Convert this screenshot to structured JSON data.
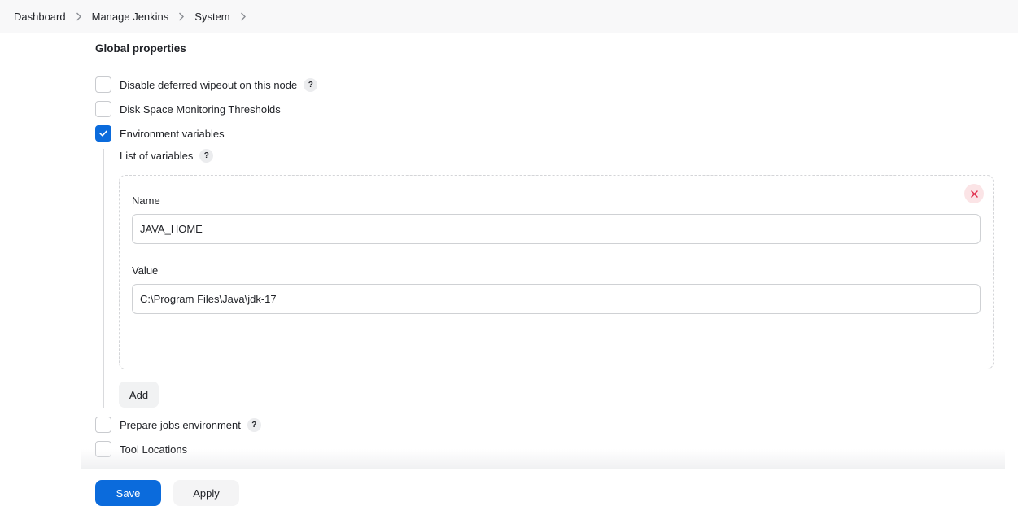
{
  "breadcrumb": {
    "items": [
      "Dashboard",
      "Manage Jenkins",
      "System"
    ],
    "separator_icon": "chevron-right-icon"
  },
  "section": {
    "title": "Global properties"
  },
  "options": {
    "disable_deferred_wipeout": {
      "label": "Disable deferred wipeout on this node",
      "checked": false,
      "help": "?"
    },
    "disk_space_monitoring": {
      "label": "Disk Space Monitoring Thresholds",
      "checked": false
    },
    "environment_variables": {
      "label": "Environment variables",
      "checked": true
    },
    "prepare_jobs_environment": {
      "label": "Prepare jobs environment",
      "checked": false,
      "help": "?"
    },
    "tool_locations": {
      "label": "Tool Locations",
      "checked": false
    }
  },
  "env_vars": {
    "list_label": "List of variables",
    "help": "?",
    "entries": [
      {
        "name_label": "Name",
        "name_value": "JAVA_HOME",
        "value_label": "Value",
        "value_value": "C:\\Program Files\\Java\\jdk-17"
      }
    ],
    "add_label": "Add"
  },
  "footer": {
    "save_label": "Save",
    "apply_label": "Apply"
  },
  "colors": {
    "primary": "#0b6bdc",
    "delete_bg": "#fbe4e6",
    "delete_icon": "#e0304e"
  }
}
